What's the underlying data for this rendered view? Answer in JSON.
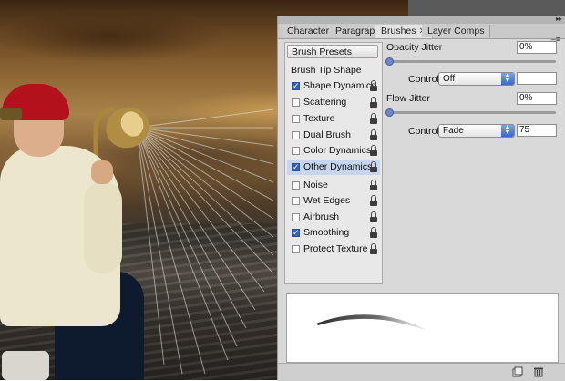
{
  "panel": {
    "tabs": [
      {
        "label": "Character"
      },
      {
        "label": "Paragraph"
      },
      {
        "label": "Brushes",
        "close": "✕"
      },
      {
        "label": "Layer Comps"
      }
    ],
    "collapse_icon": "double-chevron-right-icon",
    "menu_icon": "panel-menu-icon"
  },
  "brush_list": {
    "presets_button": "Brush Presets",
    "tip_shape": "Brush Tip Shape",
    "options": [
      {
        "label": "Shape Dynamics",
        "checked": true,
        "selected": false
      },
      {
        "label": "Scattering",
        "checked": false,
        "selected": false
      },
      {
        "label": "Texture",
        "checked": false,
        "selected": false
      },
      {
        "label": "Dual Brush",
        "checked": false,
        "selected": false
      },
      {
        "label": "Color Dynamics",
        "checked": false,
        "selected": false
      },
      {
        "label": "Other Dynamics",
        "checked": true,
        "selected": true
      },
      {
        "label": "Noise",
        "checked": false,
        "selected": false
      },
      {
        "label": "Wet Edges",
        "checked": false,
        "selected": false
      },
      {
        "label": "Airbrush",
        "checked": false,
        "selected": false
      },
      {
        "label": "Smoothing",
        "checked": true,
        "selected": false
      },
      {
        "label": "Protect Texture",
        "checked": false,
        "selected": false
      }
    ]
  },
  "settings": {
    "opacity_jitter": {
      "label": "Opacity Jitter",
      "value": "0%",
      "slider_fraction": 0
    },
    "opacity_control": {
      "label": "Control:",
      "selected": "Off",
      "value": ""
    },
    "flow_jitter": {
      "label": "Flow Jitter",
      "value": "0%",
      "slider_fraction": 0
    },
    "flow_control": {
      "label": "Control:",
      "selected": "Fade",
      "value": "75"
    }
  },
  "bottom_bar": {
    "icons": [
      "new-brush-icon",
      "trash-icon"
    ]
  },
  "colors": {
    "selected_row": "#c7d6ee",
    "accent_blue": "#3769c7",
    "hat_red": "#b3121d"
  }
}
